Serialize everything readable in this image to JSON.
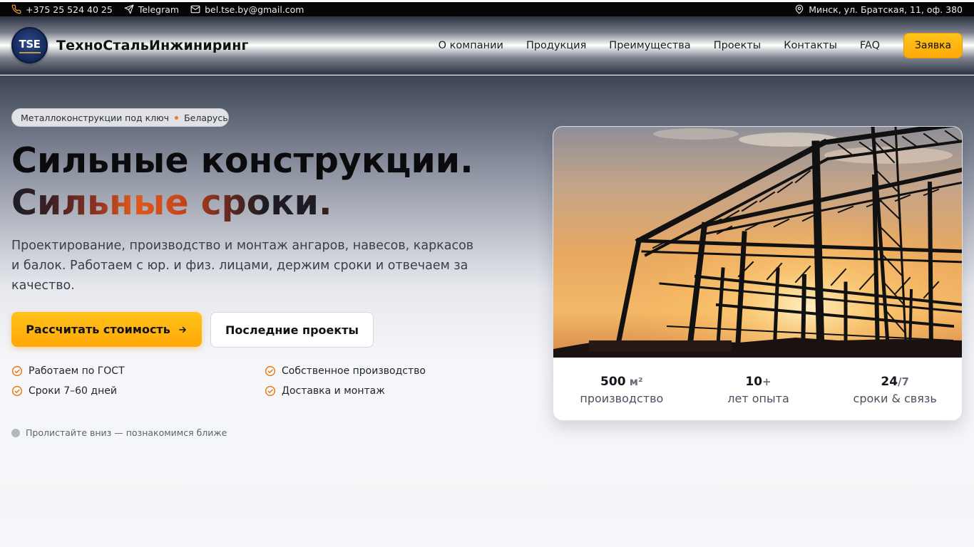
{
  "topbar": {
    "phone": "+375 25 524 40 25",
    "telegram": "Telegram",
    "email": "bel.tse.by@gmail.com",
    "address": "Минск, ул. Братская, 11, оф. 380",
    "icons": [
      "phone-icon",
      "telegram-icon",
      "mail-icon",
      "location-pin-icon"
    ]
  },
  "header": {
    "logo_text": "TSE",
    "brand": "ТехноСтальИнжиниринг",
    "nav": [
      "О компании",
      "Продукция",
      "Преимущества",
      "Проекты",
      "Контакты",
      "FAQ"
    ],
    "cta": "Заявка"
  },
  "hero": {
    "badge_left": "Металлоконструкции под ключ",
    "badge_right": "Беларусь",
    "headline_line1": "Сильные конструкции.",
    "headline_line2": "Сильные сроки",
    "headline_period": ".",
    "lead": "Проектирование, производство и монтаж ангаров, навесов, каркасов и балок. Работаем с юр. и физ. лицами, держим сроки и отвечаем за качество.",
    "btn_primary": "Рассчитать стоимость",
    "btn_secondary": "Последние проекты",
    "features": [
      "Работаем по ГОСТ",
      "Собственное производство",
      "Сроки 7–60 дней",
      "Доставка и монтаж"
    ],
    "scroll_hint": "Пролистайте вниз — познакомимся ближе"
  },
  "card": {
    "stats": [
      {
        "value": "500",
        "suffix": " м²",
        "label": "производство"
      },
      {
        "value": "10",
        "suffix": "+",
        "label": "лет опыта"
      },
      {
        "value": "24",
        "suffix": "/7",
        "label": "сроки & связь"
      }
    ]
  },
  "colors": {
    "accent": "#ffb20f",
    "accent_orange": "#f07a1a",
    "topbar_bg": "#050505"
  }
}
